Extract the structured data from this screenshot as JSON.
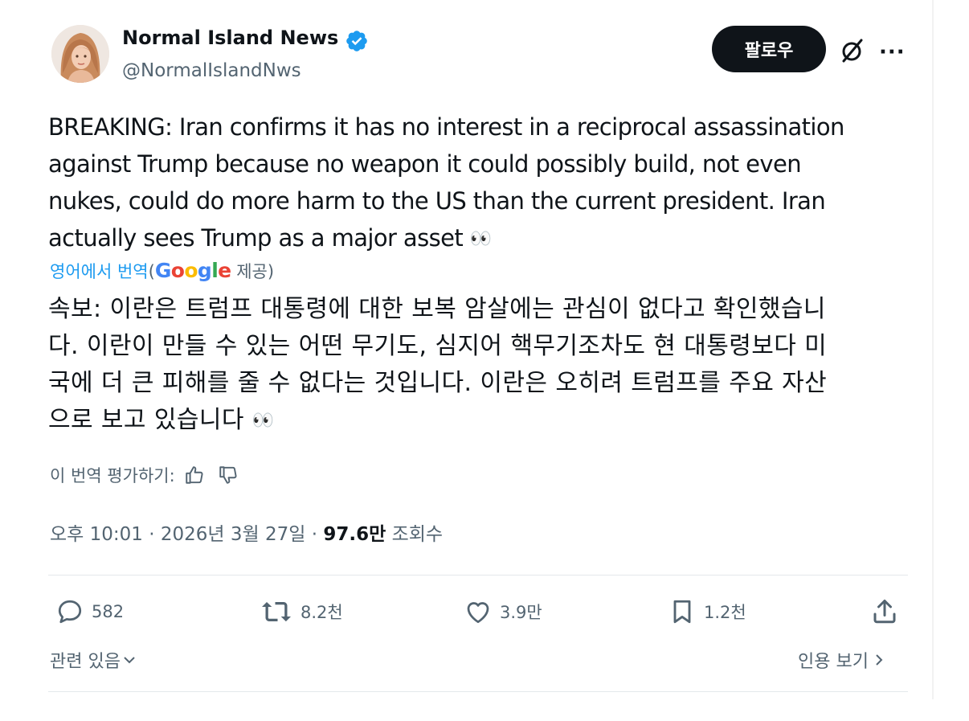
{
  "author": {
    "name": "Normal Island News",
    "handle": "@NormalIslandNws",
    "avatar_icon": "avatar-photo",
    "verified_icon": "verified-badge-icon",
    "verified_color": "#1d9bf0"
  },
  "header": {
    "follow_label": "팔로우",
    "grok_icon": "grok-icon",
    "more_icon": "more-icon"
  },
  "tweet": {
    "lines": [
      "BREAKING: Iran confirms it has no interest in a reciprocal assassination",
      "against Trump because no weapon it could possibly build, not even",
      "nukes, could do more harm to the US than the current president. Iran",
      "actually sees Trump as a major asset"
    ],
    "emoji": "👀"
  },
  "translation": {
    "link_label": "영어에서 번역",
    "open_paren": "(",
    "provider_logo": "Google",
    "provider_suffix": " 제공)",
    "lines": [
      "속보: 이란은 트럼프 대통령에 대한 보복 암살에는 관심이 없다고 확인했습니",
      "다. 이란이 만들 수 있는 어떤 무기도, 심지어 핵무기조차도 현 대통령보다 미",
      "국에 더 큰 피해를 줄 수 없다는 것입니다. 이란은 오히려 트럼프를 주요 자산",
      "으로 보고 있습니다"
    ],
    "rate_label": "이 번역 평가하기:"
  },
  "meta": {
    "time": "오후 10:01",
    "separator": " · ",
    "date": "2026년 3월 27일",
    "views_count": "97.6만",
    "views_label": " 조회수"
  },
  "actions": {
    "replies": "582",
    "reposts": "8.2천",
    "likes": "3.9만",
    "bookmarks": "1.2천"
  },
  "footer": {
    "related_label": "관련 있음",
    "quotes_label": "인용 보기"
  },
  "colors": {
    "text": "#0f1419",
    "secondary": "#536471",
    "accent": "#1d9bf0",
    "button_bg": "#0f1419"
  }
}
